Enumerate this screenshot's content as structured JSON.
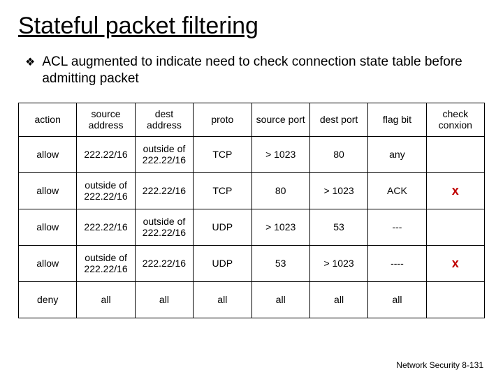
{
  "title": "Stateful packet filtering",
  "bullet": "ACL augmented to indicate need to check connection state table before admitting packet",
  "headers": [
    "action",
    "source address",
    "dest address",
    "proto",
    "source port",
    "dest port",
    "flag bit",
    "check conxion"
  ],
  "rows": [
    {
      "action": "allow",
      "src_addr": "222.22/16",
      "dst_addr": "outside of 222.22/16",
      "proto": "TCP",
      "src_port": "> 1023",
      "dst_port": "80",
      "flag": "any",
      "check": ""
    },
    {
      "action": "allow",
      "src_addr": "outside of 222.22/16",
      "dst_addr": "222.22/16",
      "proto": "TCP",
      "src_port": "80",
      "dst_port": "> 1023",
      "flag": "ACK",
      "check": "x"
    },
    {
      "action": "allow",
      "src_addr": "222.22/16",
      "dst_addr": "outside of 222.22/16",
      "proto": "UDP",
      "src_port": "> 1023",
      "dst_port": "53",
      "flag": "---",
      "check": ""
    },
    {
      "action": "allow",
      "src_addr": "outside of 222.22/16",
      "dst_addr": "222.22/16",
      "proto": "UDP",
      "src_port": "53",
      "dst_port": "> 1023",
      "flag": "----",
      "check": "x"
    },
    {
      "action": "deny",
      "src_addr": "all",
      "dst_addr": "all",
      "proto": "all",
      "src_port": "all",
      "dst_port": "all",
      "flag": "all",
      "check": ""
    }
  ],
  "footer": "Network Security   8-131"
}
